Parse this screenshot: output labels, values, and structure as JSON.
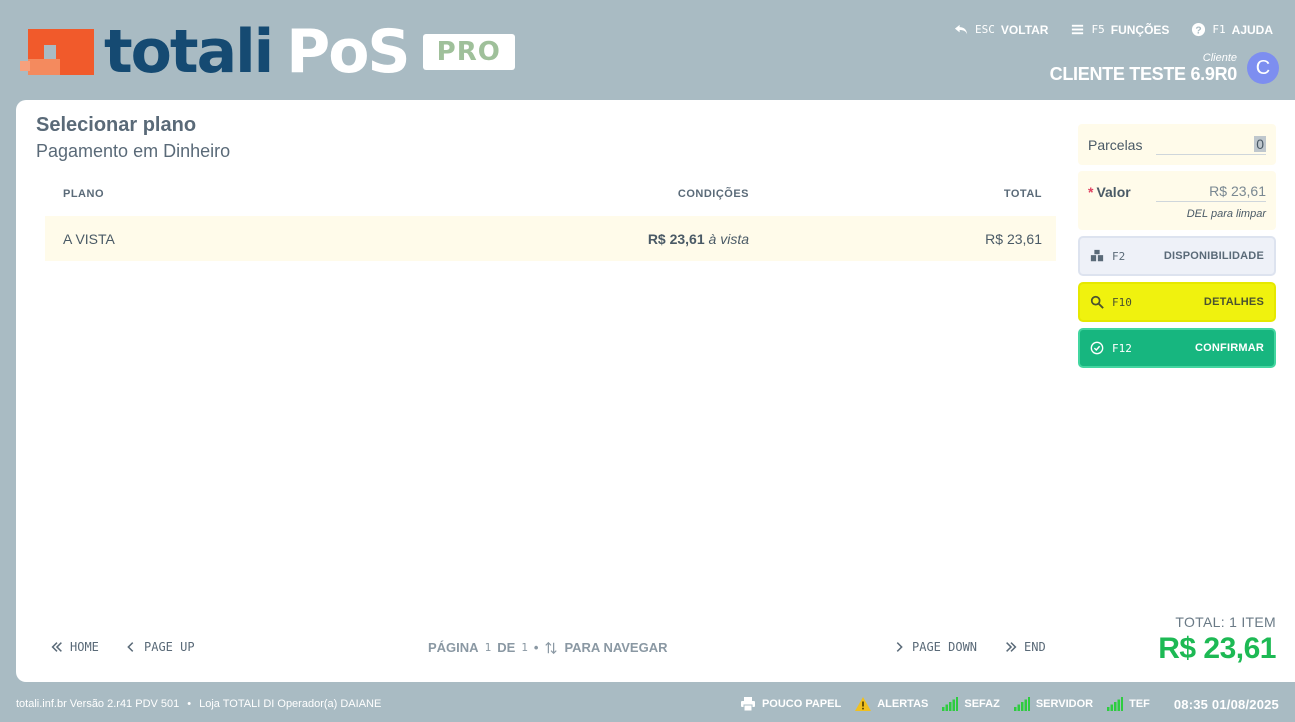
{
  "brand": {
    "word1": "totali",
    "word2": "PoS",
    "badge": "PRO"
  },
  "topnav": [
    {
      "key": "ESC",
      "label": "VOLTAR",
      "icon": "undo-icon"
    },
    {
      "key": "F5",
      "label": "FUNÇÕES",
      "icon": "menu-icon"
    },
    {
      "key": "F1",
      "label": "AJUDA",
      "icon": "help-icon"
    }
  ],
  "client": {
    "caption": "Cliente",
    "name": "CLIENTE TESTE 6.9R0",
    "avatar": "C"
  },
  "heading": {
    "title": "Selecionar plano",
    "subtitle": "Pagamento em Dinheiro"
  },
  "plans": {
    "headers": {
      "plano": "PLANO",
      "condicoes": "CONDIÇÕES",
      "total": "TOTAL"
    },
    "rows": [
      {
        "plano": "A VISTA",
        "cond_value": "R$ 23,61",
        "cond_suffix": "à vista",
        "total": "R$ 23,61"
      }
    ]
  },
  "side": {
    "parcelas": {
      "label": "Parcelas",
      "value": "0"
    },
    "valor": {
      "required": "*",
      "label": "Valor",
      "value": "R$ 23,61",
      "hint": "DEL para limpar"
    },
    "buttons": {
      "disp": {
        "key": "F2",
        "label": "DISPONIBILIDADE"
      },
      "det": {
        "key": "F10",
        "label": "DETALHES"
      },
      "conf": {
        "key": "F12",
        "label": "CONFIRMAR"
      }
    }
  },
  "pager": {
    "home": "HOME",
    "page_up": "PAGE UP",
    "page_word": "PÁGINA",
    "page_current": "1",
    "of_word": "DE",
    "page_total": "1",
    "sep": "•",
    "nav": "PARA NAVEGAR",
    "page_down": "PAGE DOWN",
    "end": "END"
  },
  "total": {
    "caption": "TOTAL: 1 ITEM",
    "value": "R$ 23,61"
  },
  "footer": {
    "info": "totali.inf.br Versão 2.r41 PDV 501",
    "sep": "•",
    "store": "Loja TOTALI DI Operador(a) DAIANE",
    "status": [
      {
        "label": "POUCO PAPEL",
        "icon": "printer-icon"
      },
      {
        "label": "ALERTAS",
        "icon": "warning-icon"
      },
      {
        "label": "SEFAZ",
        "icon": "signal-icon"
      },
      {
        "label": "SERVIDOR",
        "icon": "signal-icon"
      },
      {
        "label": "TEF",
        "icon": "signal-icon"
      }
    ],
    "time": "08:35",
    "date": "01/08/2025"
  },
  "colors": {
    "accent_green": "#1db954",
    "confirm": "#17b67f",
    "details": "#f0f20e",
    "brand_navy": "#154a72",
    "brand_orange": "#f15a2b"
  }
}
